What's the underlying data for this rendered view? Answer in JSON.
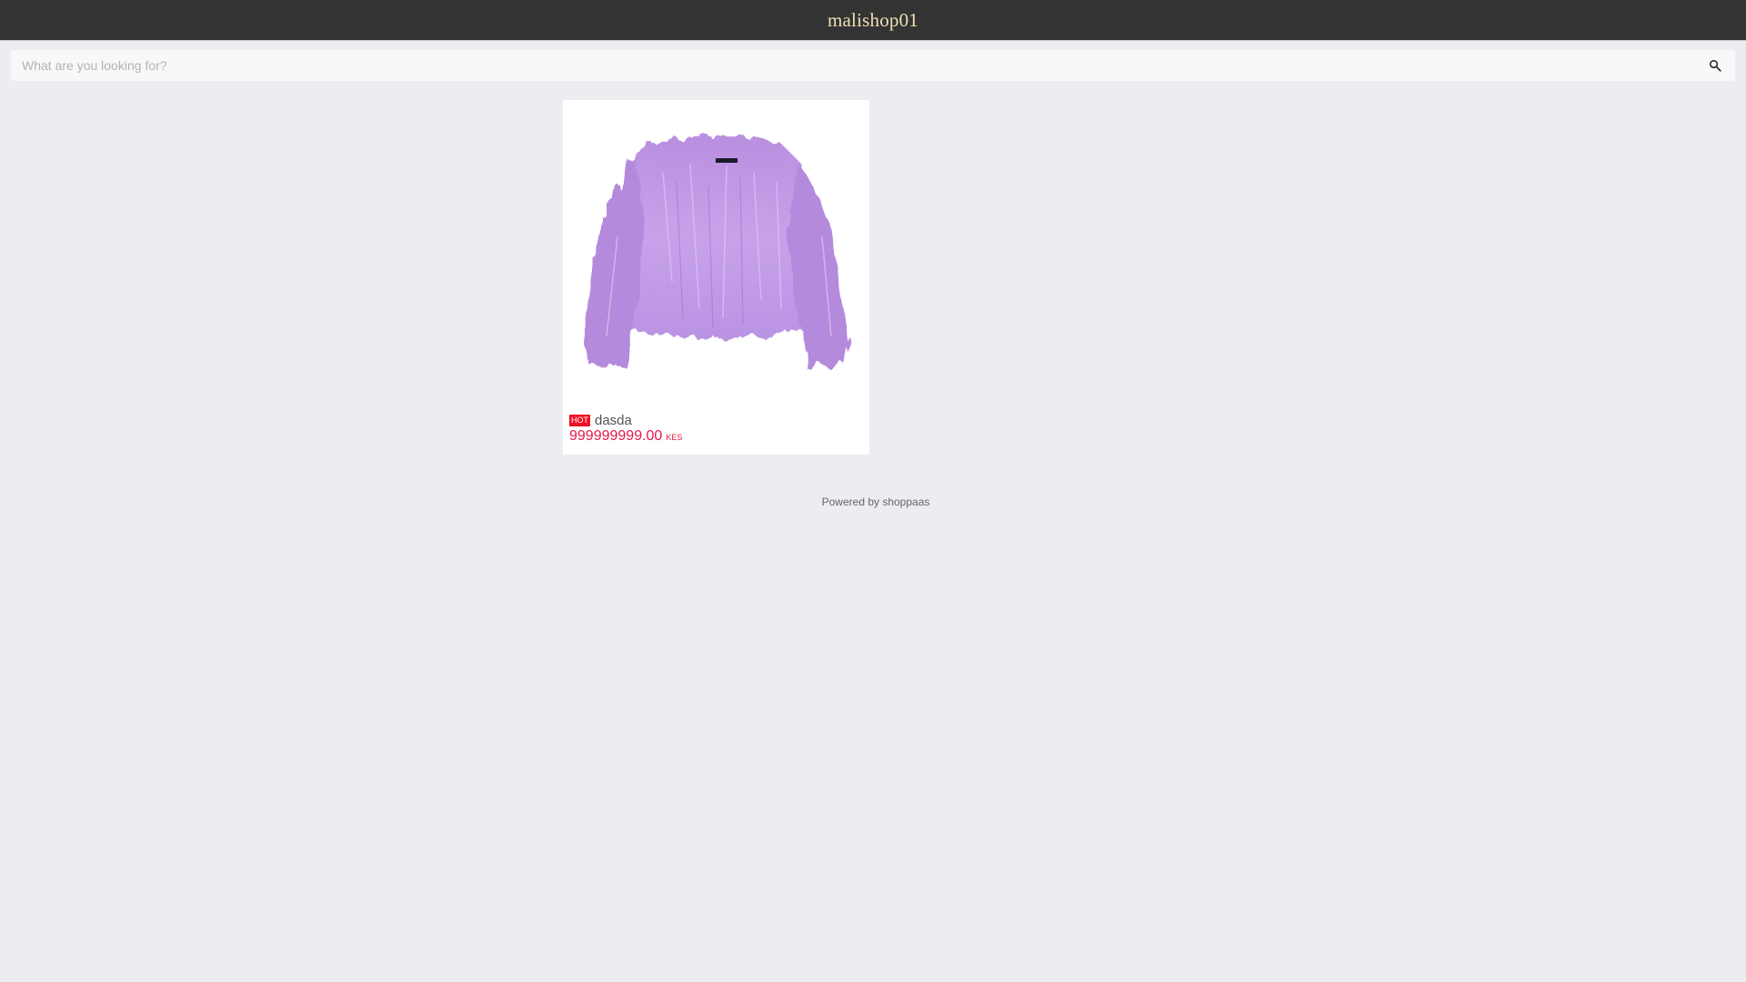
{
  "header": {
    "title": "malishop01"
  },
  "search": {
    "placeholder": "What are you looking for?",
    "value": ""
  },
  "products": [
    {
      "badge": "HOT",
      "name": "dasda",
      "price": "999999999.00",
      "currency": "KES",
      "image_icon": "purple-fluffy-sweater-image"
    }
  ],
  "footer": {
    "text": "Powered by shoppaas"
  },
  "colors": {
    "header_bg": "#333333",
    "title": "#f0e0b4",
    "page_bg": "#ebedf0",
    "badge_bg": "#ee1122",
    "price": "#e8174a"
  }
}
